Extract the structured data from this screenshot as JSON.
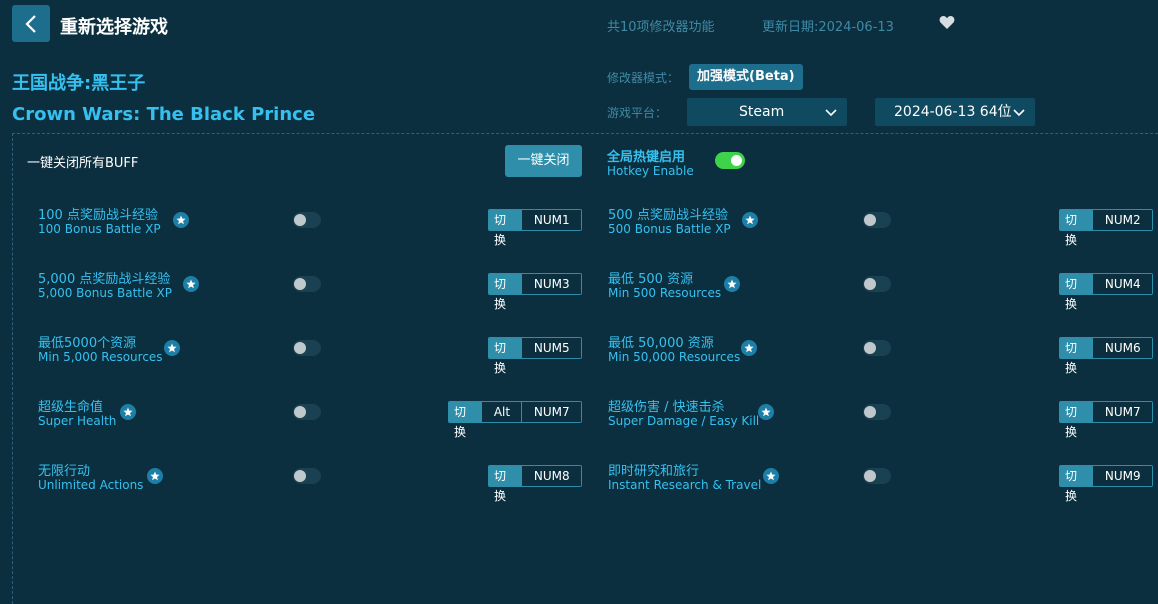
{
  "header": {
    "title": "重新选择游戏",
    "feature_count": "共10项修改器功能",
    "update_date": "更新日期:2024-06-13"
  },
  "game": {
    "title_cn": "王国战争:黑王子",
    "title_en": "Crown Wars: The Black Prince"
  },
  "meta": {
    "mode_label": "修改器模式：",
    "mode_value": "加强模式(Beta)",
    "platform_label": "游戏平台：",
    "platform_value": "Steam",
    "version_value": "2024-06-13 64位"
  },
  "controls": {
    "all_off_label": "一键关闭所有BUFF",
    "all_off_button": "一键关闭",
    "hotkey_cn": "全局热键启用",
    "hotkey_en": "Hotkey Enable",
    "hotkey_enabled": true
  },
  "switch_label": "切换",
  "cheats": [
    {
      "cn": "100 点奖励战斗经验",
      "en": "100 Bonus Battle XP",
      "keys": [
        "NUM1"
      ],
      "on": false
    },
    {
      "cn": "500 点奖励战斗经验",
      "en": "500 Bonus Battle XP",
      "keys": [
        "NUM2"
      ],
      "on": false
    },
    {
      "cn": "5,000 点奖励战斗经验",
      "en": "5,000 Bonus Battle XP",
      "keys": [
        "NUM3"
      ],
      "on": false
    },
    {
      "cn": "最低 500 资源",
      "en": "Min 500 Resources",
      "keys": [
        "NUM4"
      ],
      "on": false
    },
    {
      "cn": "最低5000个资源",
      "en": "Min 5,000 Resources",
      "keys": [
        "NUM5"
      ],
      "on": false
    },
    {
      "cn": "最低 50,000 资源",
      "en": "Min 50,000 Resources",
      "keys": [
        "NUM6"
      ],
      "on": false
    },
    {
      "cn": "超级生命值",
      "en": "Super Health",
      "keys": [
        "Alt",
        "NUM7"
      ],
      "on": false
    },
    {
      "cn": "超级伤害 / 快速击杀",
      "en": "Super Damage / Easy Kill",
      "keys": [
        "NUM7"
      ],
      "on": false
    },
    {
      "cn": "无限行动",
      "en": "Unlimited Actions",
      "keys": [
        "NUM8"
      ],
      "on": false
    },
    {
      "cn": "即时研究和旅行",
      "en": "Instant Research & Travel",
      "keys": [
        "NUM9"
      ],
      "on": false
    }
  ],
  "icons": {
    "back": "chevron-left-icon",
    "favorite": "heart-icon",
    "star": "star-icon",
    "dropdown": "chevron-down-icon"
  },
  "colors": {
    "background": "#0b2f3e",
    "accent": "#36c0f0",
    "button": "#2f8fab",
    "toggle_on": "#3ed34a"
  }
}
